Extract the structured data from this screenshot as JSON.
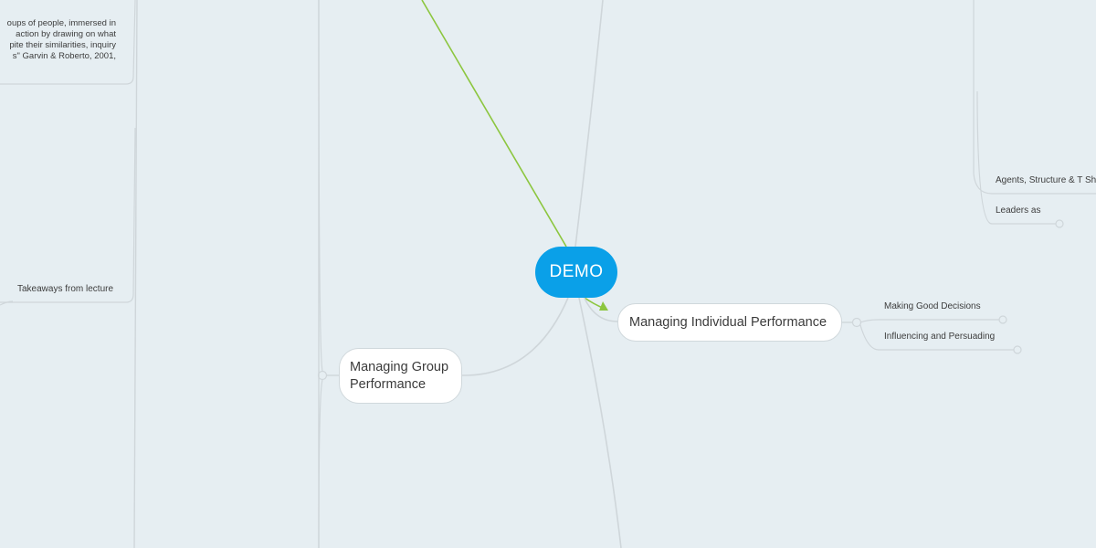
{
  "central_topic": {
    "label": "DEMO",
    "color": "#0aa0e8"
  },
  "main_topics": [
    {
      "label": "Managing Individual Performance"
    },
    {
      "label": "Managing Group Performance"
    }
  ],
  "subtopics_individual": [
    {
      "label": "Making Good Decisions"
    },
    {
      "label": "Influencing and Persuading"
    }
  ],
  "right_partial_items": [
    {
      "label": "Agents, Structure & T Sh"
    },
    {
      "label": "Leaders as"
    }
  ],
  "left_note_lines": [
    "oups of people, immersed in",
    "action by drawing on what",
    "pite their similarities, inquiry",
    "s\" Garvin & Roberto, 2001,"
  ],
  "left_item": {
    "label": "Takeaways from lecture"
  },
  "colors": {
    "background": "#e6eef2",
    "link": "#cfd6da",
    "relationship": "#8cc63f"
  }
}
